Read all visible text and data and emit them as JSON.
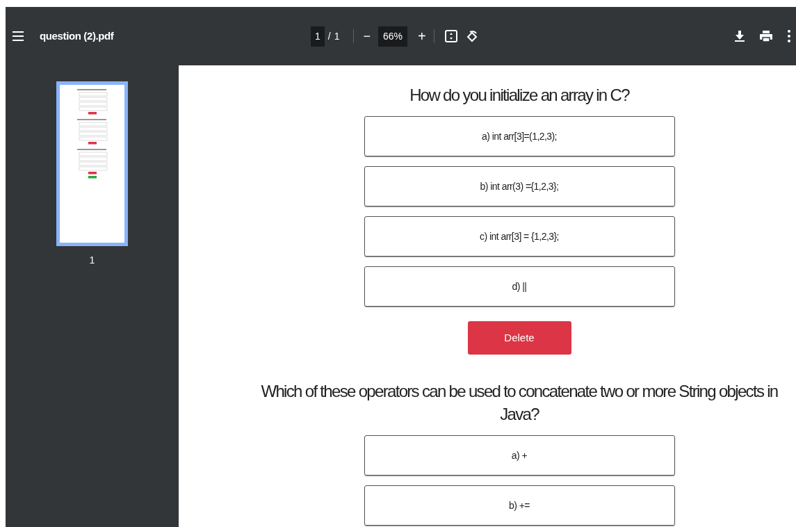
{
  "toolbar": {
    "title": "question (2).pdf",
    "page_input": "1",
    "page_separator": "/",
    "page_total": "1",
    "zoom_minus": "−",
    "zoom": "66%",
    "zoom_plus": "+"
  },
  "sidebar": {
    "thumbnails": [
      {
        "label": "1",
        "selected": true
      }
    ]
  },
  "document": {
    "questions": [
      {
        "text": "How do you initialize an array in C?",
        "options": [
          "a) int arr[3]=(1,2,3);",
          "b) int arr(3) ={1,2,3};",
          "c) int arr[3] = {1,2,3};",
          "d) ||"
        ],
        "buttons": [
          "Delete"
        ]
      },
      {
        "text": "Which of these operators can be used to concatenate two or more String objects in Java?",
        "options": [
          "a) +",
          "b) +="
        ]
      }
    ]
  }
}
